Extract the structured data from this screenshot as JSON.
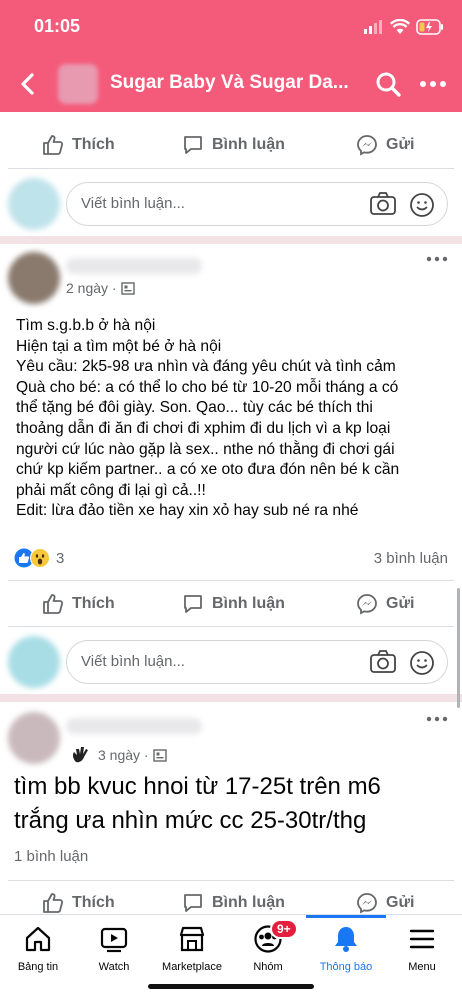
{
  "status": {
    "time": "01:05"
  },
  "header": {
    "title": "Sugar Baby Và Sugar Da..."
  },
  "actions": {
    "like": "Thích",
    "comment": "Bình luận",
    "share": "Gửi"
  },
  "composer": {
    "placeholder": "Viết bình luận..."
  },
  "post1": {
    "meta": "2 ngày · ",
    "lines": [
      "Tìm s.g.b.b ở hà nội",
      "Hiện tại a tìm một bé ở hà nội",
      "Yêu cầu: 2k5-98 ưa nhìn và đáng yêu chút và tình cảm",
      "Quà cho bé: a có thể lo cho bé từ 10-20 mỗi tháng a có",
      "thể tặng bé đôi giày. Son. Qao... tùy các bé thích thi",
      "thoảng dẫn đi ăn đi chơi đi xphim đi du lịch vì a kp loại",
      "người cứ lúc nào gặp là sex.. nthe nó thằng đi chơi gái",
      "chứ kp kiếm partner.. a có xe oto đưa đón nên bé k cần",
      "phải mất công đi lại gì cả..!!",
      "Edit: lừa đảo tiền xe hay xin xỏ hay sub né ra nhé"
    ],
    "reaction_count": "3",
    "comment_count": "3 bình luận"
  },
  "post2": {
    "meta": "3 ngày · ",
    "lines": [
      "tìm bb kvuc hnoi từ 17-25t trên m6",
      "trắng ưa nhìn mức cc 25-30tr/thg"
    ],
    "comment_count": "1 bình luận"
  },
  "tabs": [
    {
      "label": "Bảng tin",
      "icon": "home-icon"
    },
    {
      "label": "Watch",
      "icon": "watch-icon"
    },
    {
      "label": "Marketplace",
      "icon": "marketplace-icon"
    },
    {
      "label": "Nhóm",
      "icon": "groups-icon",
      "badge": "9+"
    },
    {
      "label": "Thông báo",
      "icon": "bell-icon",
      "active": true
    },
    {
      "label": "Menu",
      "icon": "menu-icon"
    }
  ],
  "colors": {
    "header": "#f45b7a",
    "accent": "#1877f2",
    "badge": "#e41e3f"
  }
}
